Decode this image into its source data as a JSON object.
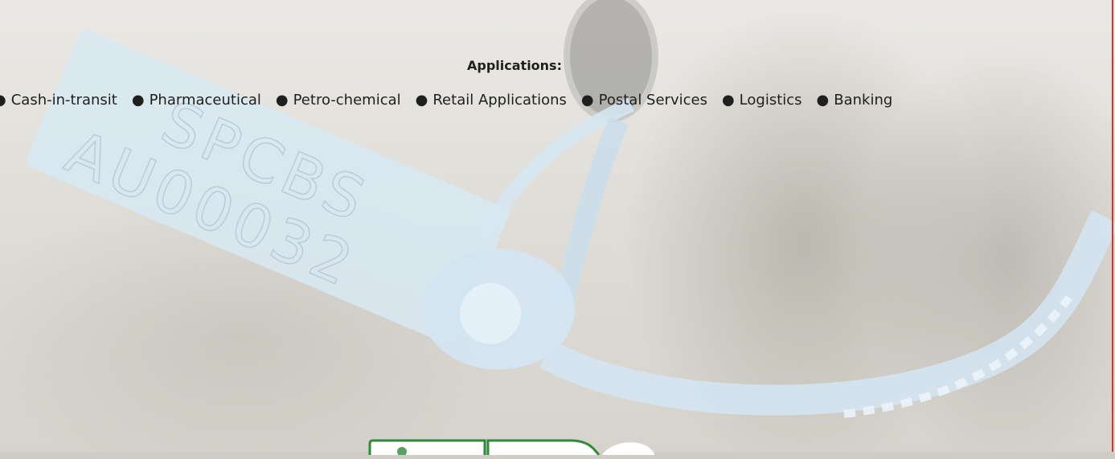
{
  "applications": {
    "title": "Applications:",
    "bullet": "●",
    "items": [
      "Cash-in-transit",
      "Pharmaceutical",
      "Petro-chemical",
      "Retail Applications",
      "Postal Services",
      "Logistics",
      "Banking"
    ]
  },
  "image": {
    "seal_text_line1": "SPCBS",
    "seal_text_line2": "AU00032",
    "accent_colors": {
      "seal": "#bfd9ea",
      "red_rule": "#d7332f",
      "logo_green": "#2f8a3b"
    }
  }
}
